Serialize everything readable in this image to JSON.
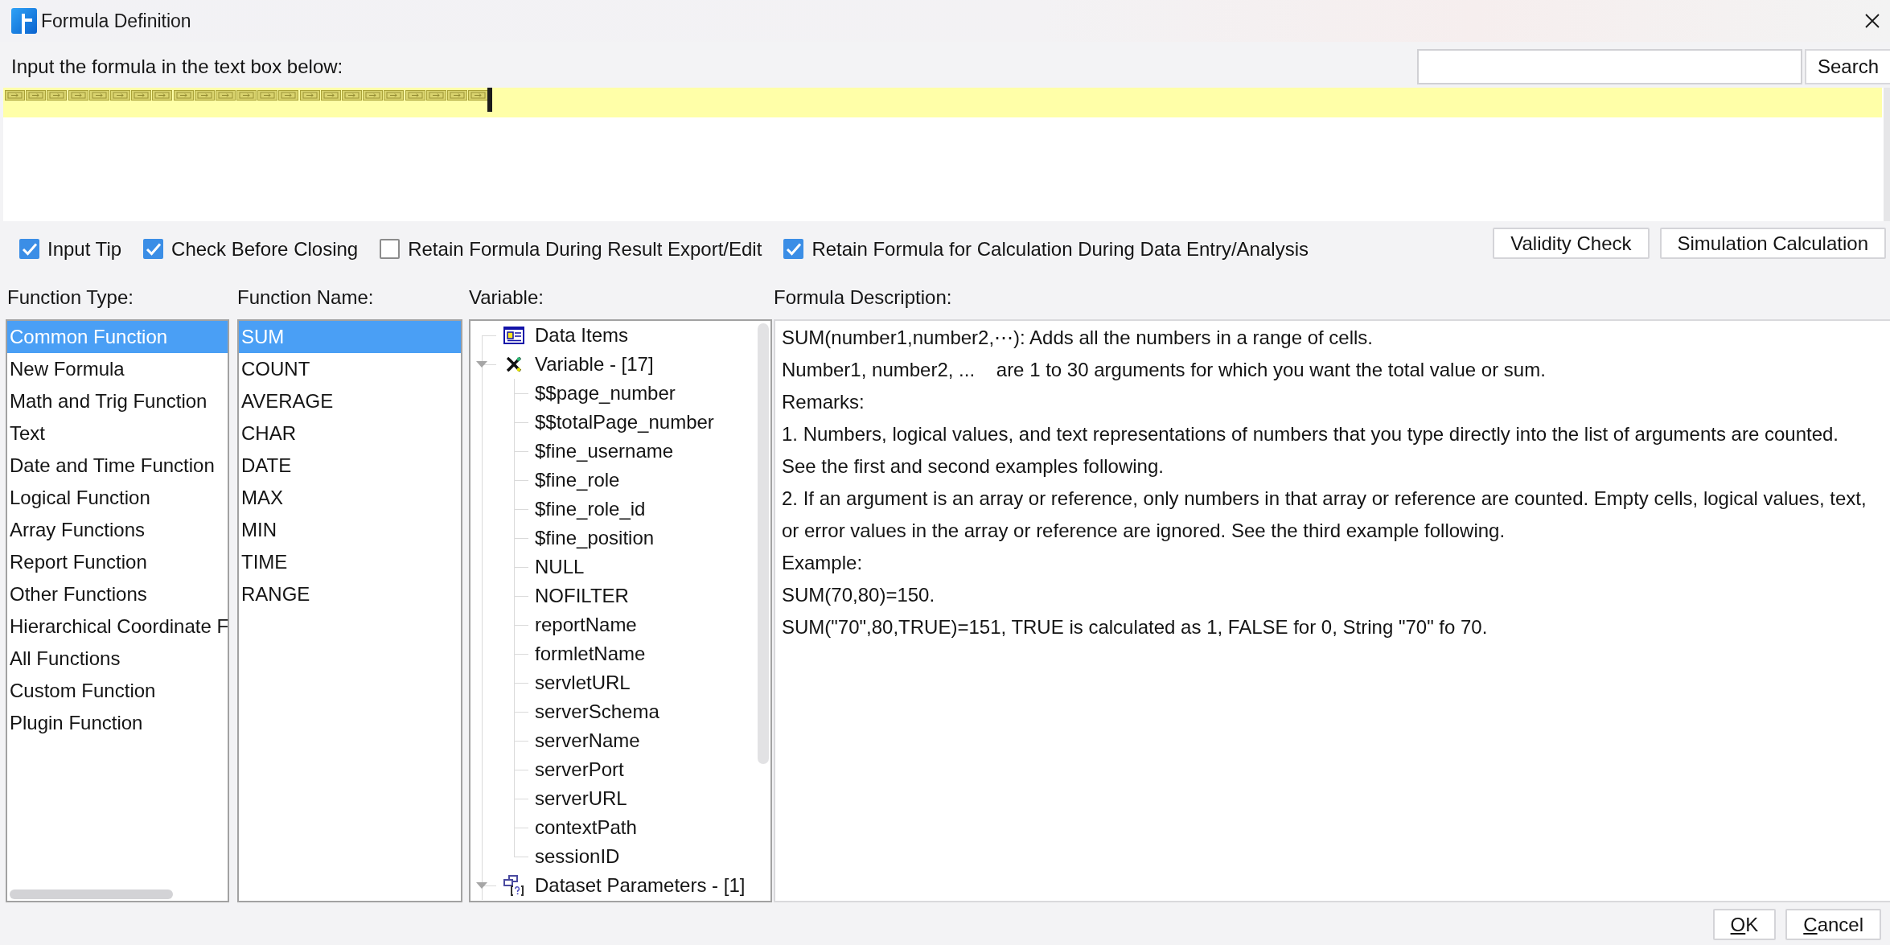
{
  "window": {
    "title": "Formula Definition"
  },
  "formula_input": {
    "label": "Input the formula in the text box below:"
  },
  "search": {
    "button": "Search"
  },
  "options": [
    {
      "label": "Input Tip",
      "checked": true
    },
    {
      "label": "Check Before Closing",
      "checked": true
    },
    {
      "label": "Retain Formula During Result Export/Edit",
      "checked": false
    },
    {
      "label": "Retain Formula for Calculation During Data Entry/Analysis",
      "checked": true
    }
  ],
  "action_buttons": [
    "Validity Check",
    "Simulation Calculation"
  ],
  "function_types": {
    "title": "Function Type:",
    "items": [
      {
        "label": "Common Function",
        "selected": true
      },
      {
        "label": "New Formula",
        "selected": false
      },
      {
        "label": "Math and Trig Function",
        "selected": false
      },
      {
        "label": "Text",
        "selected": false
      },
      {
        "label": "Date and Time Function",
        "selected": false
      },
      {
        "label": "Logical Function",
        "selected": false
      },
      {
        "label": "Array Functions",
        "selected": false
      },
      {
        "label": "Report Function",
        "selected": false
      },
      {
        "label": "Other Functions",
        "selected": false
      },
      {
        "label": "Hierarchical Coordinate F",
        "selected": false
      },
      {
        "label": "All Functions",
        "selected": false
      },
      {
        "label": "Custom Function",
        "selected": false
      },
      {
        "label": "Plugin Function",
        "selected": false
      }
    ]
  },
  "function_names": {
    "title": "Function Name:",
    "items": [
      {
        "label": "SUM",
        "selected": true
      },
      {
        "label": "COUNT",
        "selected": false
      },
      {
        "label": "AVERAGE",
        "selected": false
      },
      {
        "label": "CHAR",
        "selected": false
      },
      {
        "label": "DATE",
        "selected": false
      },
      {
        "label": "MAX",
        "selected": false
      },
      {
        "label": "MIN",
        "selected": false
      },
      {
        "label": "TIME",
        "selected": false
      },
      {
        "label": "RANGE",
        "selected": false
      }
    ]
  },
  "variables": {
    "title": "Variable:",
    "items": [
      {
        "label": "Data Items",
        "kind": "data_items"
      },
      {
        "label": "Variable - [17]",
        "kind": "variable",
        "expanded": true,
        "children": [
          {
            "label": "$$page_number"
          },
          {
            "label": "$$totalPage_number"
          },
          {
            "label": "$fine_username"
          },
          {
            "label": "$fine_role"
          },
          {
            "label": "$fine_role_id"
          },
          {
            "label": "$fine_position"
          },
          {
            "label": "NULL"
          },
          {
            "label": "NOFILTER"
          },
          {
            "label": "reportName"
          },
          {
            "label": "formletName"
          },
          {
            "label": "servletURL"
          },
          {
            "label": "serverSchema"
          },
          {
            "label": "serverName"
          },
          {
            "label": "serverPort"
          },
          {
            "label": "serverURL"
          },
          {
            "label": "contextPath"
          },
          {
            "label": "sessionID"
          }
        ]
      },
      {
        "label": "Dataset Parameters - [1]",
        "kind": "dataset_parameters",
        "expanded": true
      }
    ]
  },
  "description": {
    "title": "Formula Description:",
    "lines": [
      "SUM(number1,number2,⋯): Adds all the numbers in a range of cells.",
      "Number1, number2, ...    are 1 to 30 arguments for which you want the total value or sum.",
      "Remarks:",
      "1. Numbers, logical values, and text representations of numbers that you type directly into the list of arguments are counted.",
      "See the first and second examples following.",
      "2. If an argument is an array or reference, only numbers in that array or reference are counted. Empty cells, logical values, text,",
      "or error values in the array or reference are ignored. See the third example following.",
      "Example:",
      "SUM(70,80)=150.",
      "SUM(\"70\",80,TRUE)=151, TRUE is calculated as 1, FALSE for 0, String \"70\" fo 70."
    ]
  },
  "footer_buttons": [
    {
      "mnemonic": "O",
      "rest": "K"
    },
    {
      "mnemonic": "C",
      "rest": "ancel"
    }
  ]
}
